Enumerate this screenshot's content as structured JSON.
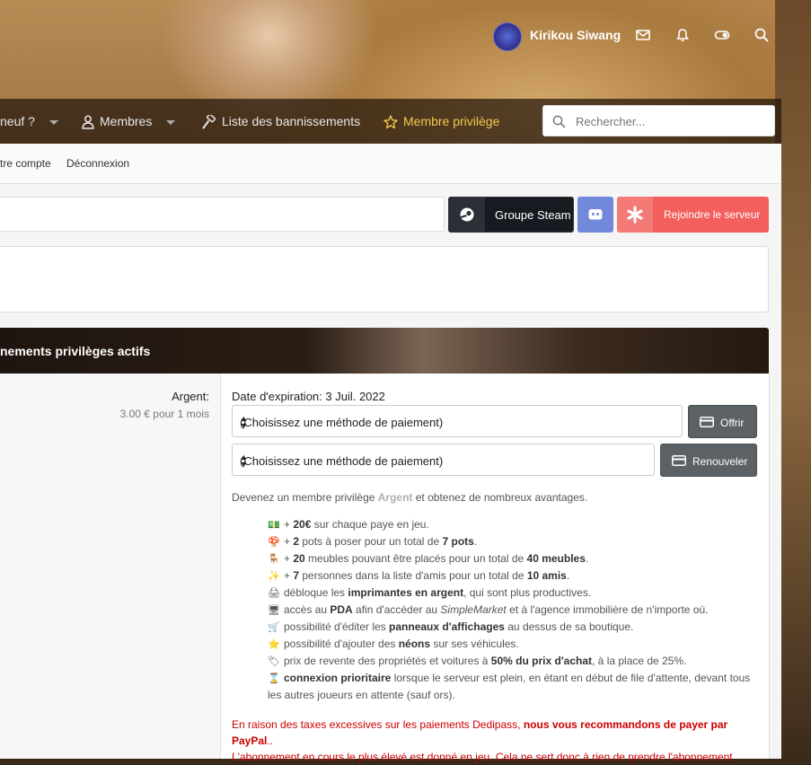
{
  "user": {
    "name": "Kirikou Siwang",
    "icons": [
      "envelope-icon",
      "bell-icon",
      "theme-toggle-icon",
      "search-icon"
    ]
  },
  "nav": {
    "items": [
      {
        "label": "neuf ?",
        "icon": "caret-icon"
      },
      {
        "label": "Membres",
        "icon": "user-icon"
      },
      {
        "label": "Liste des bannissements",
        "icon": "hammer-icon"
      },
      {
        "label": "Membre privilège",
        "icon": "star-icon"
      }
    ],
    "search_placeholder": "Rechercher...",
    "accent": "#f2c94c"
  },
  "subnav": {
    "items": [
      "tre compte",
      "Déconnexion"
    ]
  },
  "actions": {
    "steam_label": "Groupe Steam",
    "join_label": "Rejoindre le serveur",
    "discord_icon": "discord-icon",
    "join_color": "#f25f5c",
    "discord_color": "#7289da"
  },
  "section": {
    "title": "nements privilèges actifs"
  },
  "plan": {
    "name": "Argent:",
    "price": "3.00 € pour 1 mois",
    "expiry": "Date d'expiration: 3 Juil. 2022",
    "select1": "(Choisissez une méthode de paiement)",
    "select2": "(Choisissez une méthode de paiement)",
    "offer_label": "Offrir",
    "renew_label": "Renouveler"
  },
  "intro": {
    "before": "Devenez un membre privilège ",
    "highlight": "Argent",
    "after": " et obtenez de nombreux avantages."
  },
  "benefits": [
    {
      "emoji": "💵",
      "parts": [
        [
          "",
          "+ "
        ],
        [
          "b",
          "20€"
        ],
        [
          "",
          " sur chaque paye en jeu."
        ]
      ]
    },
    {
      "emoji": "🍄",
      "parts": [
        [
          "",
          "+ "
        ],
        [
          "b",
          "2"
        ],
        [
          "",
          " pots à poser pour un total de "
        ],
        [
          "b",
          "7 pots"
        ],
        [
          "",
          "."
        ]
      ]
    },
    {
      "emoji": "🪑",
      "parts": [
        [
          "",
          "+ "
        ],
        [
          "b",
          "20"
        ],
        [
          "",
          " meubles pouvant être placés pour un total de "
        ],
        [
          "b",
          "40 meubles"
        ],
        [
          "",
          "."
        ]
      ]
    },
    {
      "emoji": "✨",
      "parts": [
        [
          "",
          "+ "
        ],
        [
          "b",
          "7"
        ],
        [
          "",
          " personnes dans la liste d'amis pour un total de "
        ],
        [
          "b",
          "10 amis"
        ],
        [
          "",
          "."
        ]
      ]
    },
    {
      "emoji": "🖨",
      "parts": [
        [
          "",
          "débloque les "
        ],
        [
          "b",
          "imprimantes en argent"
        ],
        [
          "",
          ", qui sont plus productives."
        ]
      ]
    },
    {
      "emoji": "🖥",
      "parts": [
        [
          "",
          "accès au "
        ],
        [
          "b",
          "PDA"
        ],
        [
          "",
          " afin d'accéder au "
        ],
        [
          "i",
          "SimpleMarket"
        ],
        [
          "",
          " et à l'agence immobilière de n'importe où."
        ]
      ]
    },
    {
      "emoji": "🛒",
      "parts": [
        [
          "",
          "possibilité d'éditer les "
        ],
        [
          "b",
          "panneaux d'affichages"
        ],
        [
          "",
          " au dessus de sa boutique."
        ]
      ]
    },
    {
      "emoji": "⭐",
      "parts": [
        [
          "",
          "possibilité d'ajouter des "
        ],
        [
          "b",
          "néons"
        ],
        [
          "",
          " sur ses véhicules."
        ]
      ]
    },
    {
      "emoji": "🏷",
      "parts": [
        [
          "",
          "prix de revente des propriétés et voitures à "
        ],
        [
          "b",
          "50% du prix d'achat"
        ],
        [
          "",
          ", à la place de 25%."
        ]
      ]
    },
    {
      "emoji": "⌛",
      "parts": [
        [
          "b",
          "connexion prioritaire"
        ],
        [
          "",
          " lorsque le serveur est plein, en étant en début de file d'attente, devant tous les autres joueurs en attente (sauf ors)."
        ]
      ]
    }
  ],
  "warning": {
    "line1_before": "En raison des taxes excessives sur les paiements Dedipass, ",
    "line1_bold": "nous vous recommandons de payer par PayPal",
    "line1_after": "..",
    "line2": "L'abonnement en cours le plus élevé est donné en jeu. Cela ne sert donc à rien de prendre l'abonnement"
  }
}
